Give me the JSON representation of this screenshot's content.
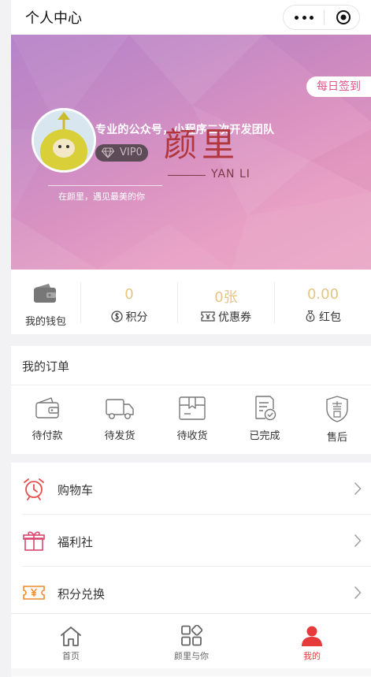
{
  "header": {
    "title": "个人中心"
  },
  "banner": {
    "sign_in": "每日签到",
    "user_name": "专业的公众号，小程序二次开发团队",
    "vip_level": "VIP0",
    "motto": "在颜里，遇见最美的你",
    "logo_cn": "颜里",
    "logo_en": "YAN LI"
  },
  "stats": {
    "wallet_label": "我的钱包",
    "points": {
      "value": "0",
      "label": "积分"
    },
    "coupons": {
      "value": "0张",
      "label": "优惠券"
    },
    "red_packets": {
      "value": "0.00",
      "label": "红包"
    },
    "value_color": "#e4c582"
  },
  "orders": {
    "title": "我的订单",
    "items": [
      {
        "label": "待付款",
        "icon": "wallet-icon"
      },
      {
        "label": "待发货",
        "icon": "truck-icon"
      },
      {
        "label": "待收货",
        "icon": "package-icon"
      },
      {
        "label": "已完成",
        "icon": "completed-doc-icon"
      },
      {
        "label": "售后",
        "icon": "after-sale-shield-icon"
      }
    ]
  },
  "menu": {
    "items": [
      {
        "label": "购物车",
        "icon": "alarm-clock-icon"
      },
      {
        "label": "福利社",
        "icon": "gift-icon"
      },
      {
        "label": "积分兑换",
        "icon": "yen-ticket-icon"
      }
    ]
  },
  "tabbar": {
    "items": [
      {
        "label": "首页",
        "icon": "home-icon"
      },
      {
        "label": "颜里与你",
        "icon": "grid-apps-icon"
      },
      {
        "label": "我的",
        "icon": "person-icon",
        "active": true
      }
    ],
    "active_color": "#e53b3b"
  }
}
